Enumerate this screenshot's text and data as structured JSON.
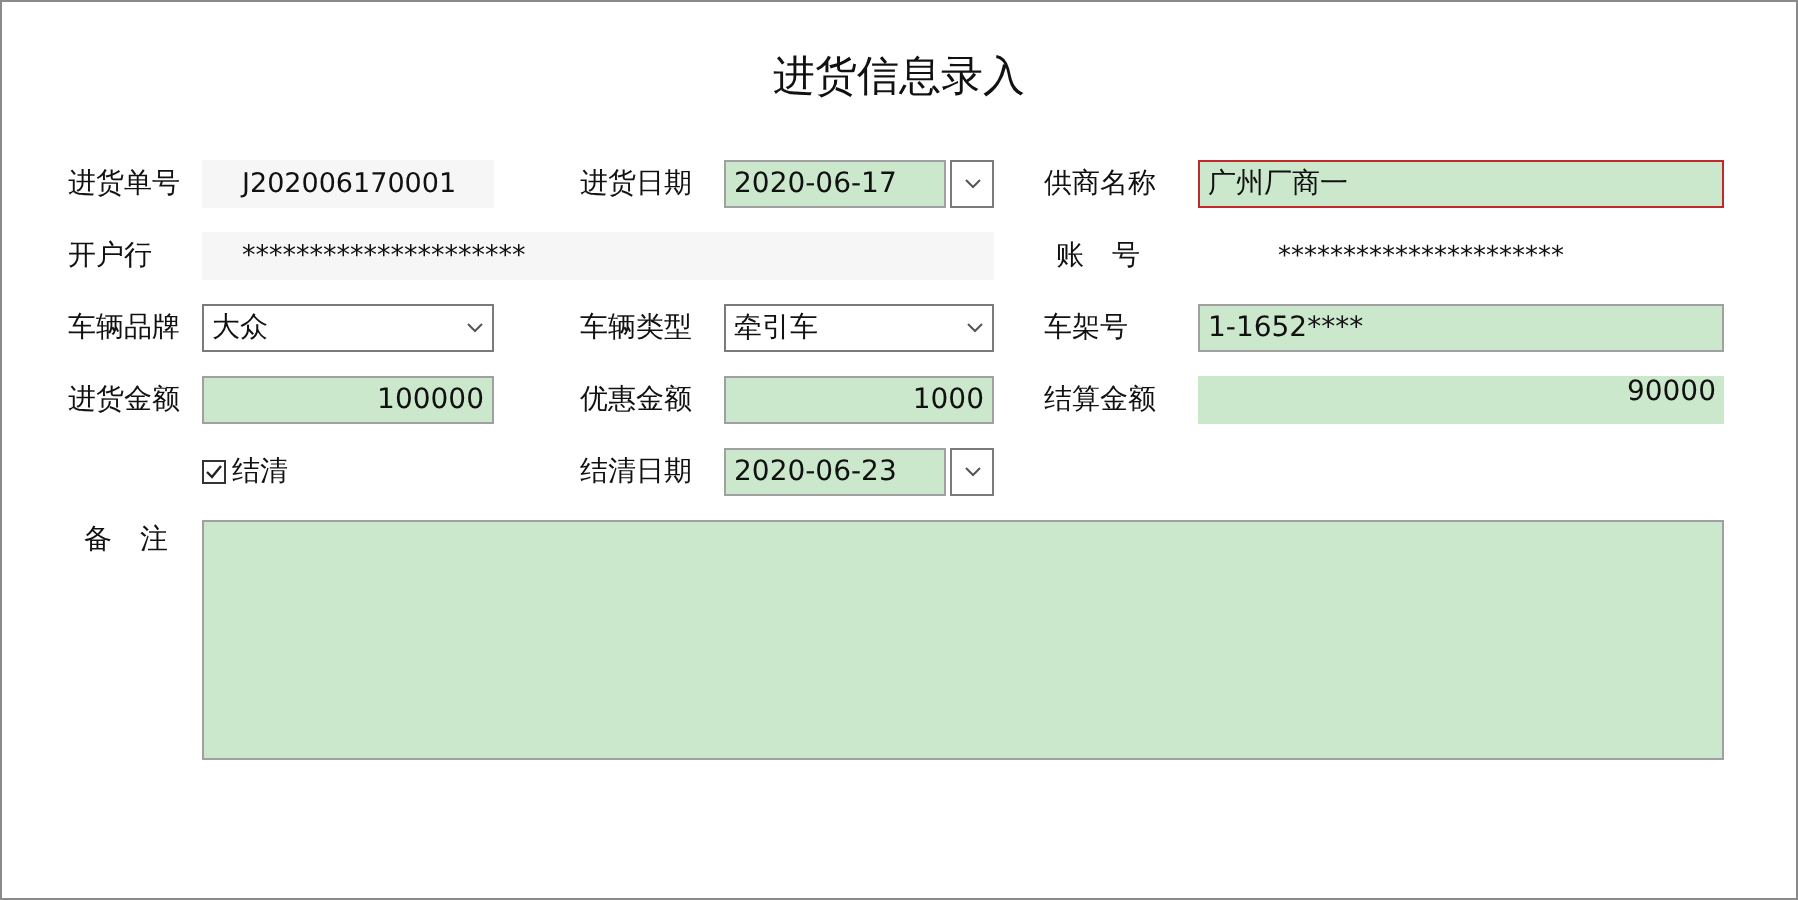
{
  "title": "进货信息录入",
  "fields": [
    {
      "label": "进货单号",
      "kind": "readonly",
      "value": "J202006170001"
    },
    {
      "label": "进货日期",
      "kind": "date",
      "value": "2020-06-17"
    },
    {
      "label": "供商名称",
      "kind": "text",
      "value": "广州厂商一",
      "focused": true
    },
    {
      "label": "开户行",
      "kind": "readonly_wide",
      "value": "*********************"
    },
    {
      "label": "账　号",
      "kind": "plain",
      "value": "**********************"
    },
    {
      "label": "车辆品牌",
      "kind": "combo",
      "value": "大众"
    },
    {
      "label": "车辆类型",
      "kind": "combo",
      "value": "牵引车"
    },
    {
      "label": "车架号",
      "kind": "text",
      "value": "1-1652****",
      "focused": false
    },
    {
      "label": "进货金额",
      "kind": "number",
      "value": "100000"
    },
    {
      "label": "优惠金额",
      "kind": "number",
      "value": "1000"
    },
    {
      "label": "结算金额",
      "kind": "flat_number",
      "value": "90000"
    },
    {
      "kind": "checkbox",
      "label": "结清",
      "checked": true
    },
    {
      "label": "结清日期",
      "kind": "date",
      "value": "2020-06-23"
    },
    {
      "label": "备　注",
      "kind": "memo"
    }
  ]
}
